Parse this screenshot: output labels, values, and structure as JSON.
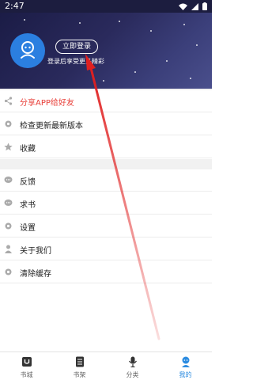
{
  "status": {
    "time": "2:47"
  },
  "header": {
    "login_label": "立即登录",
    "login_hint": "登录后享受更多精彩"
  },
  "menu": {
    "share": "分享APP给好友",
    "update": "检查更新最新版本",
    "favorite": "收藏",
    "feedback": "反馈",
    "request": "求书",
    "settings": "设置",
    "about": "关于我们",
    "clear_cache": "清除缓存"
  },
  "tabs": [
    {
      "label": "书城",
      "icon": "bookstore-icon"
    },
    {
      "label": "书架",
      "icon": "bookshelf-icon"
    },
    {
      "label": "分类",
      "icon": "category-icon"
    },
    {
      "label": "我的",
      "icon": "profile-icon",
      "active": true
    }
  ],
  "colors": {
    "accent": "#2b8be0",
    "share_text": "#e8403a",
    "header_bg": "#2a2a5c",
    "annotation_arrow": "#e02020"
  }
}
